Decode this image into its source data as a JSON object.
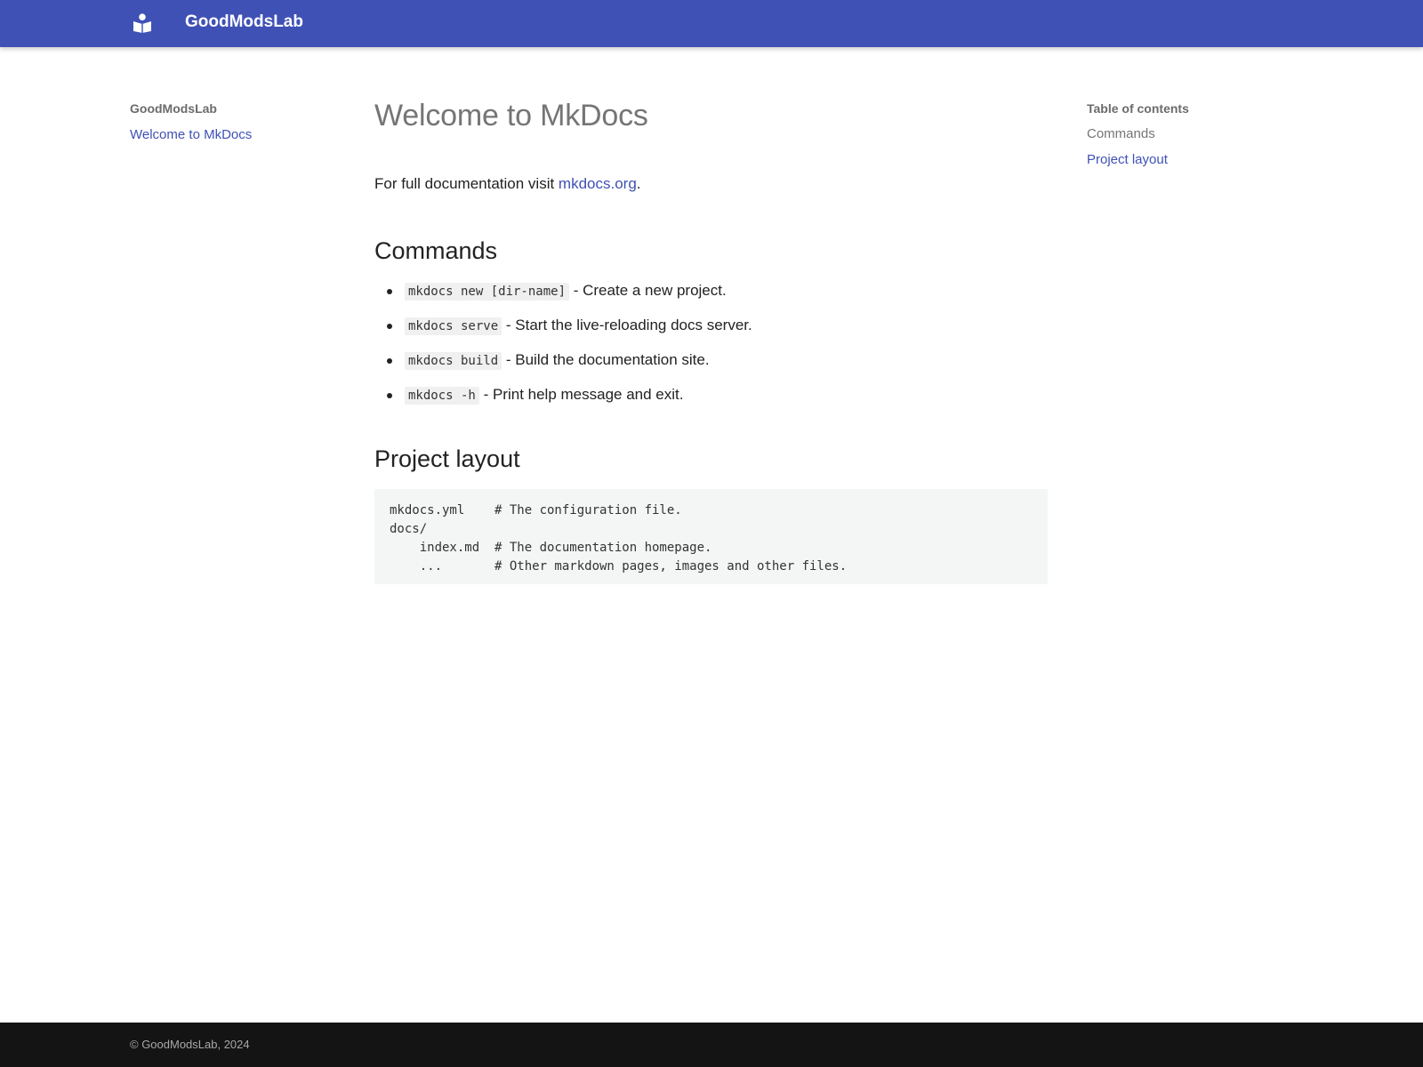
{
  "header": {
    "site_name": "GoodModsLab",
    "logo_icon": "book-reader-icon",
    "color": "#3f51b5"
  },
  "sidebar": {
    "title": "GoodModsLab",
    "items": [
      {
        "label": "Welcome to MkDocs"
      }
    ]
  },
  "toc": {
    "title": "Table of contents",
    "items": [
      {
        "label": "Commands"
      },
      {
        "label": "Project layout"
      }
    ]
  },
  "content": {
    "title": "Welcome to MkDocs",
    "intro_text": "For full documentation visit ",
    "intro_link": "mkdocs.org",
    "intro_suffix": ".",
    "commands_heading": "Commands",
    "commands": [
      {
        "code": "mkdocs new [dir-name]",
        "desc": " - Create a new project."
      },
      {
        "code": "mkdocs serve",
        "desc": " - Start the live-reloading docs server."
      },
      {
        "code": "mkdocs build",
        "desc": " - Build the documentation site."
      },
      {
        "code": "mkdocs -h",
        "desc": " - Print help message and exit."
      }
    ],
    "layout_heading": "Project layout",
    "layout_code": "mkdocs.yml    # The configuration file.\ndocs/\n    index.md  # The documentation homepage.\n    ...       # Other markdown pages, images and other files."
  },
  "footer": {
    "text": "© GoodModsLab, 2024"
  }
}
